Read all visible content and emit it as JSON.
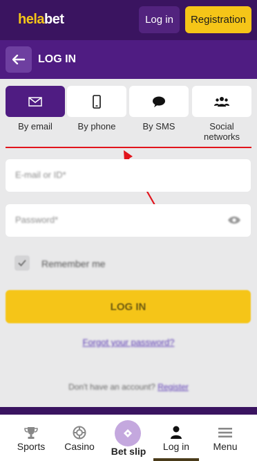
{
  "header": {
    "logo_part1": "hela",
    "logo_part2": "bet",
    "login_label": "Log in",
    "registration_label": "Registration"
  },
  "titlebar": {
    "title": "LOG IN"
  },
  "tabs": [
    {
      "label": "By email",
      "icon": "envelope-icon",
      "active": true
    },
    {
      "label": "By phone",
      "icon": "phone-icon",
      "active": false
    },
    {
      "label": "By SMS",
      "icon": "chat-bubble-icon",
      "active": false
    },
    {
      "label": "Social\nnetworks",
      "icon": "people-icon",
      "active": false
    }
  ],
  "form": {
    "email_placeholder": "E-mail or ID*",
    "password_placeholder": "Password*",
    "remember_label": "Remember me",
    "remember_checked": true,
    "submit_label": "LOG IN",
    "forgot_label": "Forgot your password?",
    "no_account_text": "Don't have an account?",
    "register_link": "Register"
  },
  "bottom_nav": {
    "items": [
      {
        "label": "Sports",
        "icon": "trophy-icon"
      },
      {
        "label": "Casino",
        "icon": "chip-icon"
      },
      {
        "label": "Bet slip",
        "icon": "ticket-icon"
      },
      {
        "label": "Log in",
        "icon": "user-icon",
        "active": true
      },
      {
        "label": "Menu",
        "icon": "hamburger-icon"
      }
    ]
  },
  "colors": {
    "brand_purple": "#4f1c82",
    "header_purple": "#3a1460",
    "accent_yellow": "#f5c518",
    "annotation_red": "#e1141c"
  }
}
